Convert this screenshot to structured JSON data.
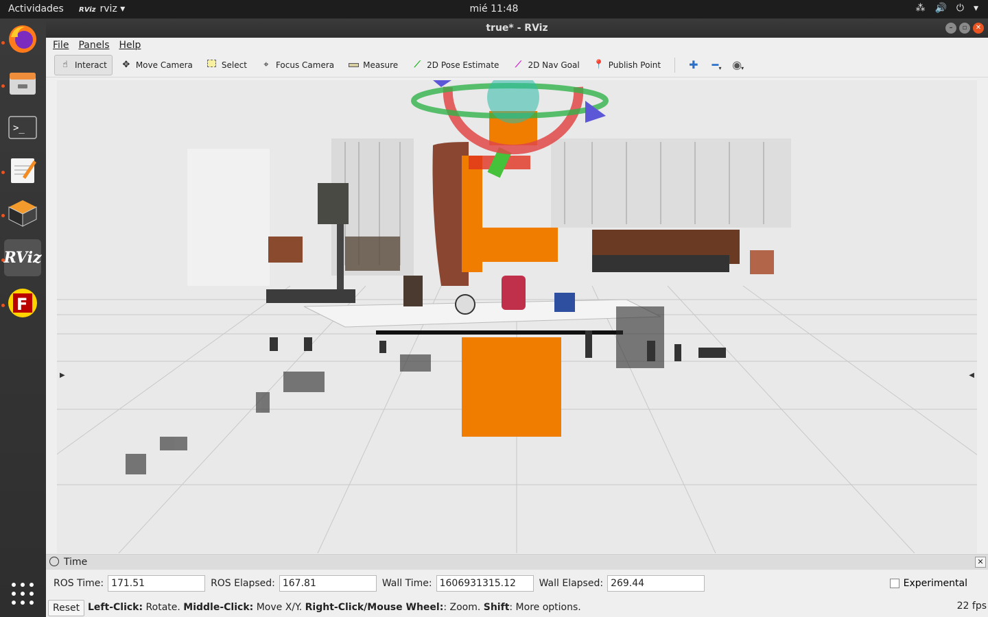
{
  "topbar": {
    "activities": "Actividades",
    "app_name": "rviz",
    "app_icon_text": "RViz",
    "clock": "mié 11:48"
  },
  "dock": {
    "apps": [
      "firefox",
      "files",
      "terminal",
      "text-editor",
      "virtualbox",
      "rviz",
      "filezilla"
    ],
    "rviz_label": "RViz"
  },
  "window": {
    "title": "true* - RViz"
  },
  "menu": {
    "file": "File",
    "panels": "Panels",
    "help": "Help"
  },
  "toolbar": {
    "interact": "Interact",
    "move_camera": "Move Camera",
    "select": "Select",
    "focus_camera": "Focus Camera",
    "measure": "Measure",
    "pose_estimate": "2D Pose Estimate",
    "nav_goal": "2D Nav Goal",
    "publish_point": "Publish Point"
  },
  "time_panel": {
    "title": "Time",
    "ros_time_label": "ROS Time:",
    "ros_time": "171.51",
    "ros_elapsed_label": "ROS Elapsed:",
    "ros_elapsed": "167.81",
    "wall_time_label": "Wall Time:",
    "wall_time": "1606931315.12",
    "wall_elapsed_label": "Wall Elapsed:",
    "wall_elapsed": "269.44",
    "experimental": "Experimental"
  },
  "status": {
    "reset": "Reset",
    "hint_left_bold": "Left-Click:",
    "hint_left": " Rotate. ",
    "hint_middle_bold": "Middle-Click:",
    "hint_middle": " Move X/Y. ",
    "hint_right_bold": "Right-Click/Mouse Wheel:",
    "hint_right": ": Zoom. ",
    "hint_shift_bold": "Shift",
    "hint_shift": ": More options.",
    "fps": "22 fps"
  }
}
